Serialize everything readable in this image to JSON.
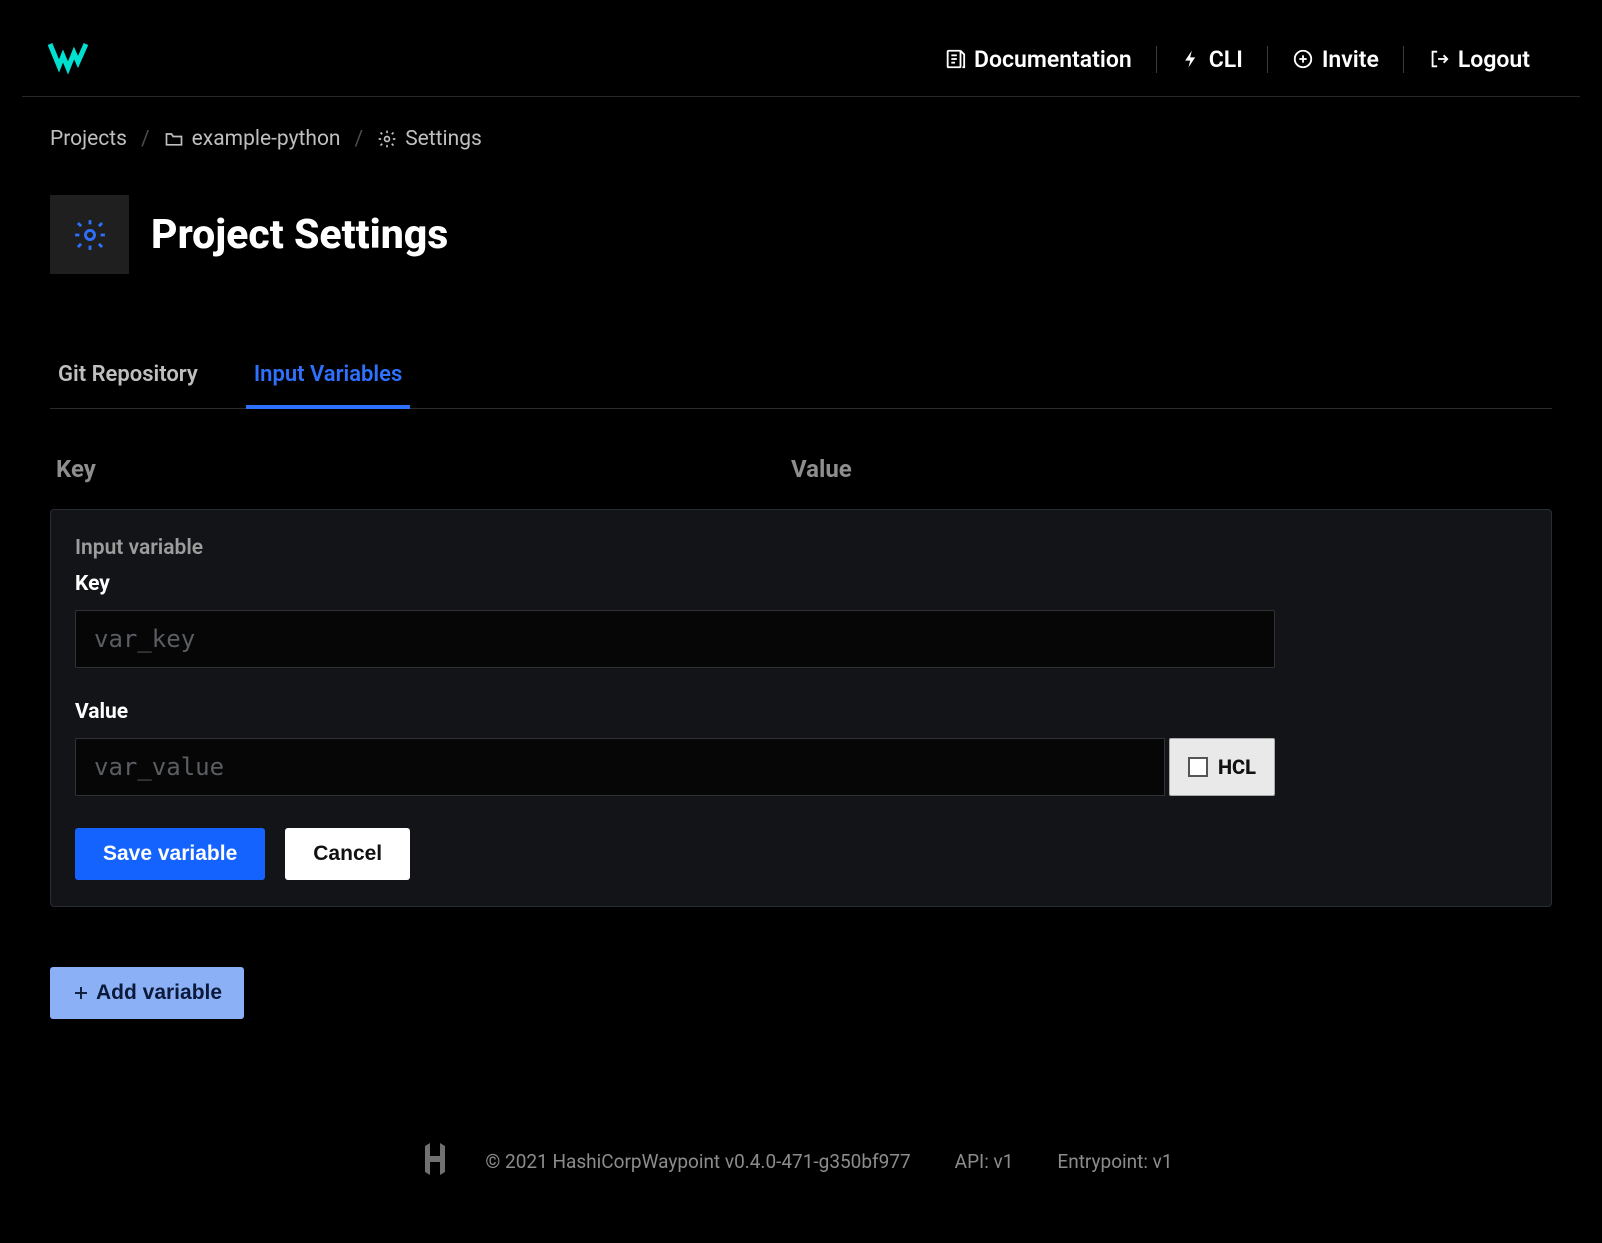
{
  "nav": {
    "documentation": "Documentation",
    "cli": "CLI",
    "invite": "Invite",
    "logout": "Logout"
  },
  "breadcrumb": {
    "projects": "Projects",
    "project_name": "example-python",
    "settings": "Settings"
  },
  "page_title": "Project Settings",
  "tabs": {
    "git": "Git Repository",
    "input_vars": "Input Variables"
  },
  "table_headers": {
    "key": "Key",
    "value": "Value"
  },
  "var_form": {
    "title": "Input variable",
    "key_label": "Key",
    "key_placeholder": "var_key",
    "value_label": "Value",
    "value_placeholder": "var_value",
    "hcl_label": "HCL",
    "save_btn": "Save variable",
    "cancel_btn": "Cancel"
  },
  "add_variable_btn": "Add variable",
  "footer": {
    "copyright": "© 2021 HashiCorp",
    "version": "Waypoint v0.4.0-471-g350bf977",
    "api": "API: v1",
    "entrypoint": "Entrypoint: v1"
  }
}
